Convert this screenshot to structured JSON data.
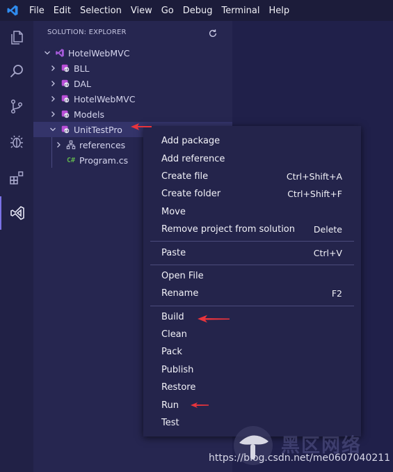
{
  "menubar": {
    "items": [
      "File",
      "Edit",
      "Selection",
      "View",
      "Go",
      "Debug",
      "Terminal",
      "Help"
    ]
  },
  "activitybar": {
    "icons": [
      "files-icon",
      "search-icon",
      "source-control-icon",
      "debug-icon",
      "extensions-icon",
      "solution-explorer-icon"
    ]
  },
  "sidebar": {
    "title": "SOLUTION: EXPLORER",
    "tree": {
      "solution": "HotelWebMVC",
      "projects": [
        "BLL",
        "DAL",
        "HotelWebMVC",
        "Models",
        "UnitTestPro"
      ],
      "children": [
        "references",
        "Program.cs"
      ],
      "cs_badge": "C#"
    }
  },
  "context_menu": {
    "groups": [
      [
        {
          "label": "Add package",
          "shortcut": ""
        },
        {
          "label": "Add reference",
          "shortcut": ""
        },
        {
          "label": "Create file",
          "shortcut": "Ctrl+Shift+A"
        },
        {
          "label": "Create folder",
          "shortcut": "Ctrl+Shift+F"
        },
        {
          "label": "Move",
          "shortcut": ""
        },
        {
          "label": "Remove project from solution",
          "shortcut": "Delete"
        }
      ],
      [
        {
          "label": "Paste",
          "shortcut": "Ctrl+V"
        }
      ],
      [
        {
          "label": "Open File",
          "shortcut": ""
        },
        {
          "label": "Rename",
          "shortcut": "F2"
        }
      ],
      [
        {
          "label": "Build",
          "shortcut": ""
        },
        {
          "label": "Clean",
          "shortcut": ""
        },
        {
          "label": "Pack",
          "shortcut": ""
        },
        {
          "label": "Publish",
          "shortcut": ""
        },
        {
          "label": "Restore",
          "shortcut": ""
        },
        {
          "label": "Run",
          "shortcut": ""
        },
        {
          "label": "Test",
          "shortcut": ""
        }
      ]
    ]
  },
  "watermark": {
    "brand_text": "黑区网络",
    "url": "https://blog.csdn.net/me0607040211"
  },
  "colors": {
    "accent": "#7a72e6",
    "arrow": "#e8343c",
    "project_icon": "#b84fd6"
  }
}
